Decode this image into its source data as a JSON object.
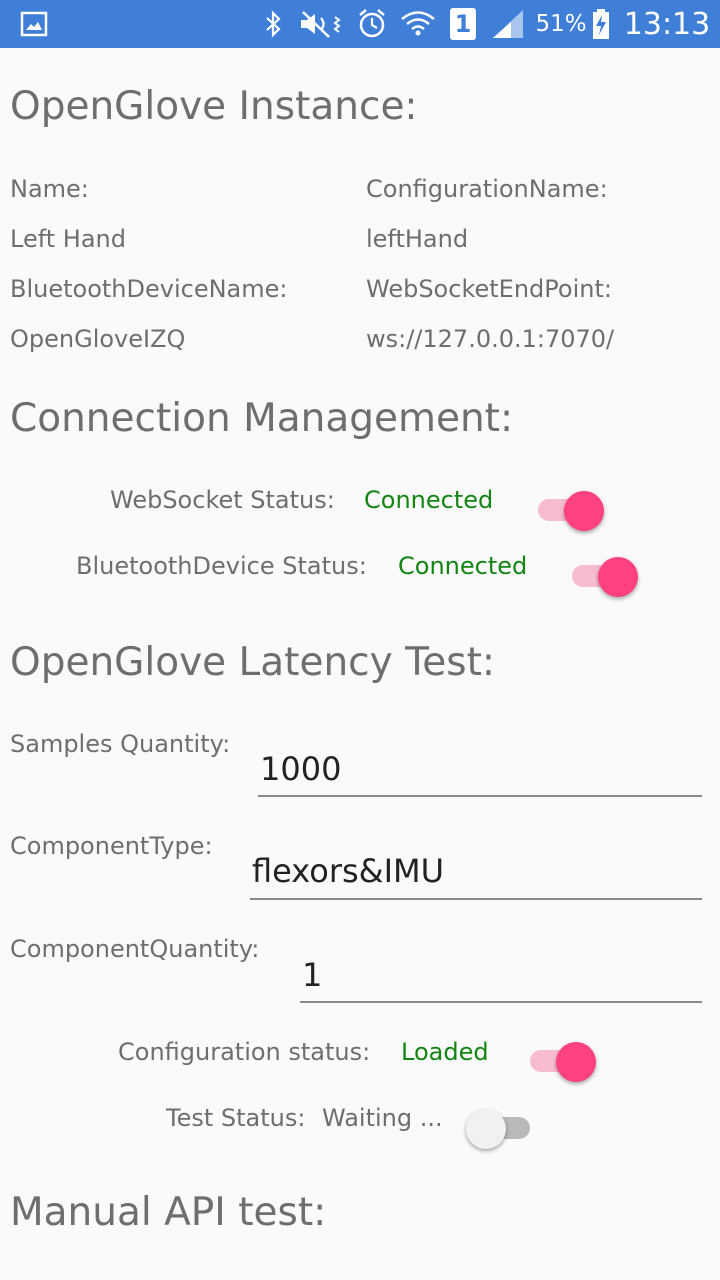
{
  "status_bar": {
    "battery_percent": "51%",
    "time": "13:13",
    "sim_number": "1",
    "icons": [
      "gallery-icon",
      "bluetooth-icon",
      "mute-icon",
      "alarm-icon",
      "wifi-icon",
      "sim-icon",
      "signal-icon",
      "battery-charging-icon"
    ],
    "bar_color": "#3f7fd8"
  },
  "instance": {
    "heading": "OpenGlove Instance:",
    "name_label": "Name:",
    "name_value": "Left Hand",
    "config_label": "ConfigurationName:",
    "config_value": "leftHand",
    "bt_label": "BluetoothDeviceName:",
    "bt_value": "OpenGloveIZQ",
    "ws_label": "WebSocketEndPoint:",
    "ws_value": "ws://127.0.0.1:7070/"
  },
  "connection": {
    "heading": "Connection Management:",
    "websocket_label": "WebSocket Status:",
    "websocket_value": "Connected",
    "websocket_switch_on": true,
    "bluetooth_label": "BluetoothDevice Status:",
    "bluetooth_value": "Connected",
    "bluetooth_switch_on": true
  },
  "latency": {
    "heading": "OpenGlove Latency Test:",
    "samples_label": "Samples Quantity:",
    "samples_value": "1000",
    "component_type_label": "ComponentType:",
    "component_type_value": "flexors&IMU",
    "component_quantity_label": "ComponentQuantity:",
    "component_quantity_value": "1",
    "config_status_label": "Configuration status:",
    "config_status_value": "Loaded",
    "config_switch_on": true,
    "test_status_label": "Test Status:",
    "test_status_value": "Waiting ...",
    "test_switch_on": false
  },
  "manual": {
    "heading": "Manual API test:"
  },
  "colors": {
    "accent": "#ff4081",
    "success": "#138513"
  }
}
